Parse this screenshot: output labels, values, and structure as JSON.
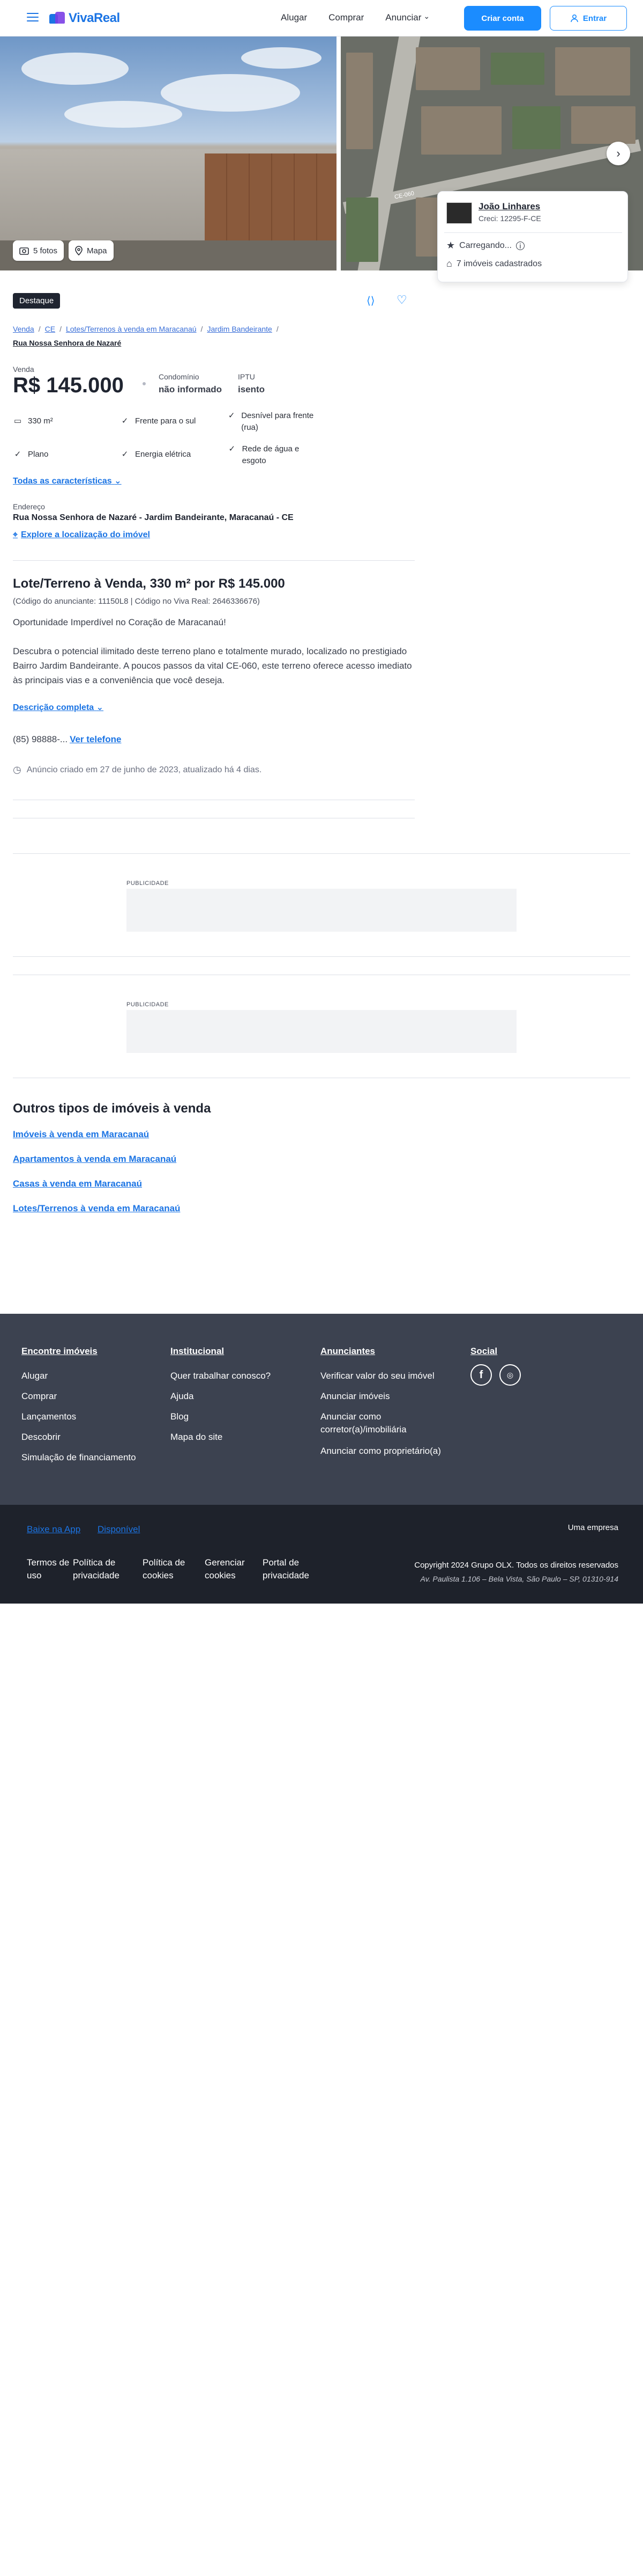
{
  "header": {
    "logo_text": "VivaReal",
    "nav": [
      "Alugar",
      "Comprar",
      "Anunciar"
    ],
    "create_account": "Criar conta",
    "login": "Entrar",
    "colors": {
      "primary": "#1b8cff",
      "brand": "#1b74e4"
    }
  },
  "gallery": {
    "photos_label": "5 fotos",
    "map_label": "Mapa",
    "map_road_label": "CE-060"
  },
  "agent": {
    "name": "João Linhares",
    "creci": "Creci: 12295-F-CE",
    "rating": "Carregando...",
    "listings": "7 imóveis cadastrados"
  },
  "listing": {
    "badge": "Destaque",
    "breadcrumb": [
      "Venda",
      "CE",
      "Lotes/Terrenos à venda em Maracanaú",
      "Jardim Bandeirante"
    ],
    "breadcrumb_last": "Rua Nossa Senhora de Nazaré",
    "price_label": "Venda",
    "price": "R$ 145.000",
    "condo_label": "Condomínio",
    "condo_value": "não informado",
    "iptu_label": "IPTU",
    "iptu_value": "isento",
    "features": [
      "330 m²",
      "Frente para o sul",
      "Desnível para frente (rua)",
      "Plano",
      "Energia elétrica",
      "Rede de água e esgoto"
    ],
    "all_features": "Todas as características",
    "address_label": "Endereço",
    "address": "Rua Nossa Senhora de Nazaré - Jardim Bandeirante, Maracanaú - CE",
    "explore_location": "Explore a localização do imóvel",
    "title": "Lote/Terreno à Venda, 330 m² por R$ 145.000",
    "codes": "(Código do anunciante: 11150L8 | Código no Viva Real: 2646336676)",
    "description_1": "Oportunidade Imperdível no Coração de Maracanaú!",
    "description_2": "Descubra o potencial ilimitado deste terreno plano e totalmente murado, localizado no prestigiado Bairro Jardim Bandeirante. A poucos passos da vital CE-060, este terreno oferece acesso imediato às principais vias e a conveniência que você deseja.",
    "full_description": "Descrição completa",
    "phone": "(85) 98888-...",
    "see_phone": "Ver telefone",
    "announcement": "Anúncio criado em 27 de junho de 2023, atualizado há 4 dias."
  },
  "ads": {
    "label": "PUBLICIDADE"
  },
  "other_types": {
    "title": "Outros tipos de imóveis à venda",
    "links": [
      "Imóveis à venda em Maracanaú",
      "Apartamentos à venda em Maracanaú",
      "Casas à venda em Maracanaú",
      "Lotes/Terrenos à venda em Maracanaú"
    ]
  },
  "footer": {
    "col1_title": "Encontre imóveis",
    "col1": [
      "Alugar",
      "Comprar",
      "Lançamentos",
      "Descobrir",
      "Simulação de financiamento"
    ],
    "col2_title": "Institucional",
    "col2": [
      "Quer trabalhar conosco?",
      "Ajuda",
      "Blog",
      "Mapa do site"
    ],
    "col3_title": "Anunciantes",
    "col3": [
      "Verificar valor do seu imóvel",
      "Anunciar imóveis",
      "Anunciar como corretor(a)/imobiliária",
      "Anunciar como proprietário(a)"
    ],
    "col4_title": "Social",
    "social_icons": [
      "facebook-icon",
      "instagram-icon"
    ],
    "app_store": "Baixe na App",
    "google_play": "Disponível",
    "bottom_links": [
      "Termos de uso",
      "Política de privacidade",
      "Política de cookies",
      "Gerenciar cookies",
      "Portal de privacidade"
    ],
    "company": "Uma empresa",
    "company_brand": "Grupo OLX",
    "copyright": "Copyright 2024 Grupo OLX. Todos os direitos reservados",
    "address": "Av. Paulista 1.106 – Bela Vista, São Paulo – SP, 01310-914"
  }
}
